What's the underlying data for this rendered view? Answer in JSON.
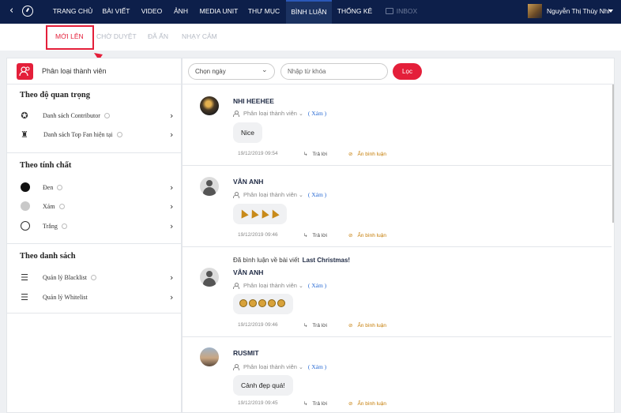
{
  "nav": {
    "items": [
      "TRANG CHỦ",
      "BÀI VIẾT",
      "VIDEO",
      "ẢNH",
      "MEDIA UNIT",
      "THƯ MỤC",
      "BÌNH LUẬN",
      "THỐNG KÊ",
      "INBOX"
    ],
    "active": "BÌNH LUẬN",
    "user_name": "Nguyễn Thị Thùy Nhi"
  },
  "subtabs": [
    "MỚI LÊN",
    "CHỜ DUYỆT",
    "ĐÃ ẨN",
    "NHẠY CẢM"
  ],
  "subtab_active": "MỚI LÊN",
  "sidebar": {
    "header": "Phân loại thành viên",
    "sections": [
      {
        "title": "Theo độ quan trọng",
        "items": [
          {
            "label": "Danh sách Contributor",
            "icon": "star-badge-icon"
          },
          {
            "label": "Danh sách Top Fan hiện tại",
            "icon": "trophy-icon"
          }
        ]
      },
      {
        "title": "Theo tính chất",
        "items": [
          {
            "label": "Đen",
            "icon": "black-dot-icon"
          },
          {
            "label": "Xám",
            "icon": "gray-dot-icon"
          },
          {
            "label": "Trắng",
            "icon": "white-dot-icon"
          }
        ]
      },
      {
        "title": "Theo danh sách",
        "items": [
          {
            "label": "Quản lý Blacklist",
            "icon": "sliders-icon"
          },
          {
            "label": "Quản lý Whitelist",
            "icon": "sliders-icon"
          }
        ]
      }
    ]
  },
  "filters": {
    "date_select": "Chọn ngày",
    "keyword_placeholder": "Nhập từ khóa",
    "filter_button": "Lọc"
  },
  "comments": [
    {
      "name": "NHI HEEHEE",
      "meta": "Phân loại thành viên",
      "view": "( Xám )",
      "text": "Nice",
      "time": "19/12/2019 09:54",
      "reply": "Trả lời",
      "hide": "Ẩn bình luận"
    },
    {
      "name": "VÂN ANH",
      "meta": "Phân loại thành viên",
      "view": "( Xám )",
      "text": "",
      "time": "19/12/2019 09:46",
      "reply": "Trả lời",
      "hide": "Ẩn bình luận"
    },
    {
      "context": "Đã bình luận về bài viết",
      "context_post": "Last Christmas!",
      "name": "VÂN ANH",
      "meta": "Phân loại thành viên",
      "view": "( Xám )",
      "text": "",
      "time": "19/12/2019 09:46",
      "reply": "Trả lời",
      "hide": "Ẩn bình luận"
    },
    {
      "name": "RUSMIT",
      "meta": "Phân loại thành viên",
      "view": "( Xám )",
      "text": "Cảnh đẹp quá!",
      "time": "19/12/2019 09:45",
      "reply": "Trả lời",
      "hide": "Ẩn bình luận"
    }
  ],
  "colors": {
    "nav_bg": "#0d1f4a",
    "accent": "#e41f3a",
    "link": "#2b6cd4"
  }
}
